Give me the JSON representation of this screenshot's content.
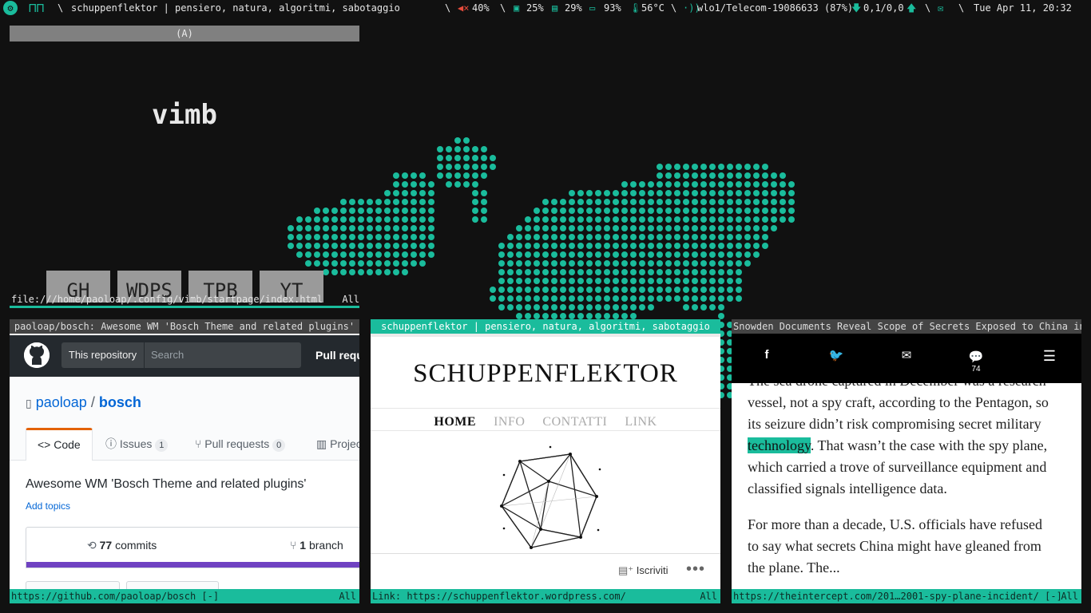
{
  "topbar": {
    "title": "schuppenflektor | pensiero, natura, algoritmi, sabotaggio",
    "volume": "40%",
    "cpu": "25%",
    "mem": "29%",
    "battery": "93%",
    "temp": "56°C",
    "wifi": "wlo1/Telecom-19086633 (87%)",
    "net": "0,1/0,0",
    "clock": "Tue Apr 11, 20:32"
  },
  "vimb": {
    "title": "(A)",
    "logo": "vimb",
    "quicklinks": [
      "GH",
      "WDPS",
      "TPB",
      "YT"
    ],
    "status_url": "file:///home/paoloap/.config/vimb/startpage/index.html",
    "status_pos": "All"
  },
  "github": {
    "title": "paoloap/bosch: Awesome WM 'Bosch Theme and related plugins'",
    "scope": "This repository",
    "search_placeholder": "Search",
    "pull_requests": "Pull requests",
    "owner": "paoloap",
    "repo_sep": "/",
    "repo": "bosch",
    "tabs": [
      {
        "label": "Code"
      },
      {
        "label": "Issues",
        "count": "1"
      },
      {
        "label": "Pull requests",
        "count": "0"
      },
      {
        "label": "Projects"
      }
    ],
    "description": "Awesome WM 'Bosch Theme and related plugins'",
    "add_topics": "Add topics",
    "commits_count": "77",
    "commits_label": "commits",
    "branch_count": "1",
    "branch_label": "branch",
    "status_url": "https://github.com/paoloap/bosch [-]",
    "status_pos": "All"
  },
  "wordpress": {
    "title": "schuppenflektor | pensiero, natura, algoritmi, sabotaggio",
    "site_name": "SCHUPPENFLEKTOR",
    "nav": [
      "HOME",
      "INFO",
      "CONTATTI",
      "LINK"
    ],
    "subscribe": "Iscriviti",
    "status_url": "Link: https://schuppenflektor.wordpress.com/",
    "status_pos": "All"
  },
  "intercept": {
    "title": "Snowden Documents Reveal Scope of Secrets Exposed to China in…",
    "comment_count": "74",
    "para1_a": "The sea drone captured in December was a research vessel, not a spy craft, according to the Pentagon, so its seizure didn’t risk compromising secret military",
    "para1_hl": "technology",
    "para1_b": ". That wasn’t the case with the spy plane, which carried a trove of surveillance equipment and classified signals intelligence data.",
    "para2": "For more than a decade, U.S. officials have refused to say what secrets China might have gleaned from the plane. The...",
    "status_url": "https://theintercept.com/201…2001-spy-plane-incident/ [-]",
    "status_pos": "All"
  },
  "colors": {
    "accent": "#1abc9c",
    "background": "#111111"
  }
}
